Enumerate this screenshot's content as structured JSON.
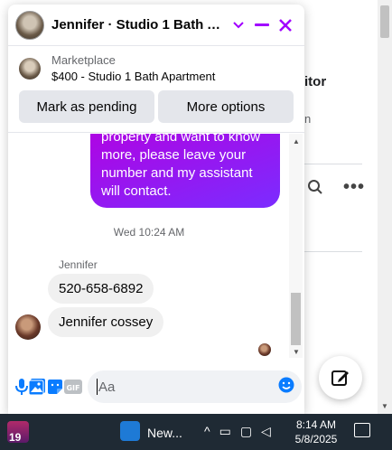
{
  "background": {
    "partial_heading": "itor",
    "partial_text": "n",
    "more_label": "•••"
  },
  "chat": {
    "title": "Jennifer · Studio 1 Bath Ap...",
    "marketplace_label": "Marketplace",
    "listing": "$400 - Studio 1 Bath Apartment",
    "mark_pending_label": "Mark as pending",
    "more_options_label": "More options",
    "sent_message": "property and want to know more, please leave your number and my assistant will contact.",
    "timestamp": "Wed 10:24 AM",
    "sender_name": "Jennifer",
    "received_messages": [
      "520-658-6892",
      "Jennifer cossey"
    ],
    "composer_placeholder": "Aa",
    "accent_color": "#a100ff"
  },
  "taskbar": {
    "badge_count": "19",
    "news_label": "New...",
    "time": "8:14 AM",
    "date": "5/8/2025"
  }
}
